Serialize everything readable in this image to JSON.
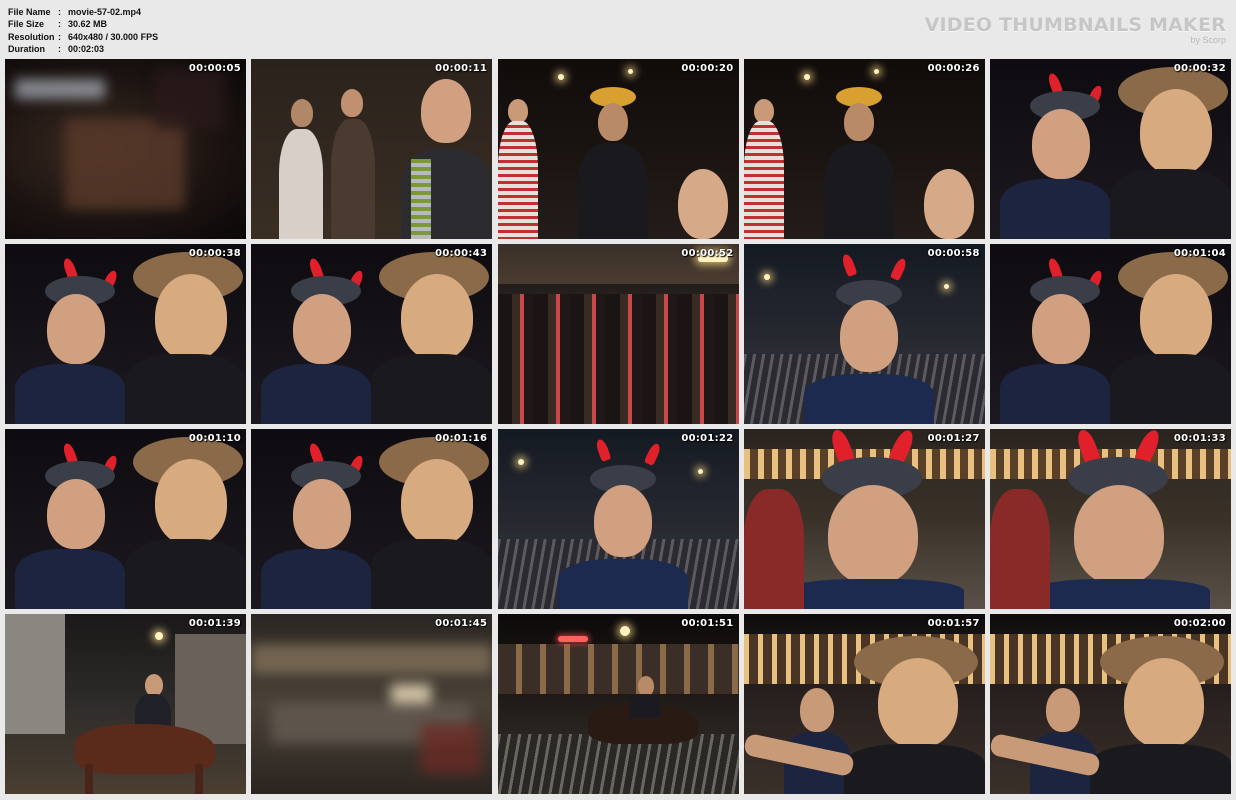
{
  "info": {
    "file_name_label": "File Name",
    "file_name": "movie-57-02.mp4",
    "file_size_label": "File Size",
    "file_size": "30.62 MB",
    "resolution_label": "Resolution",
    "resolution": "640x480 / 30.000 FPS",
    "duration_label": "Duration",
    "duration": "00:02:03",
    "separator": ":"
  },
  "brand": {
    "title": "VIDEO THUMBNAILS MAKER",
    "subtitle": "by Scorp"
  },
  "thumbnails": [
    {
      "timestamp": "00:00:05",
      "scene": "blur-crowd"
    },
    {
      "timestamp": "00:00:11",
      "scene": "crowd-man-closeup"
    },
    {
      "timestamp": "00:00:20",
      "scene": "police-crowd"
    },
    {
      "timestamp": "00:00:26",
      "scene": "police-crowd"
    },
    {
      "timestamp": "00:00:32",
      "scene": "two-men-horns-hat"
    },
    {
      "timestamp": "00:00:38",
      "scene": "two-men-horns-hat"
    },
    {
      "timestamp": "00:00:43",
      "scene": "two-men-horns-hat"
    },
    {
      "timestamp": "00:00:52",
      "scene": "street-crowd"
    },
    {
      "timestamp": "00:00:58",
      "scene": "horned-man-street"
    },
    {
      "timestamp": "00:01:04",
      "scene": "two-men-horns-hat"
    },
    {
      "timestamp": "00:01:10",
      "scene": "two-men-horns-hat"
    },
    {
      "timestamp": "00:01:16",
      "scene": "two-men-horns-hat"
    },
    {
      "timestamp": "00:01:22",
      "scene": "horned-man-street"
    },
    {
      "timestamp": "00:01:27",
      "scene": "horned-man-closeup"
    },
    {
      "timestamp": "00:01:33",
      "scene": "horned-man-closeup"
    },
    {
      "timestamp": "00:01:39",
      "scene": "horse-rider"
    },
    {
      "timestamp": "00:01:45",
      "scene": "blur-street"
    },
    {
      "timestamp": "00:01:51",
      "scene": "horse-street-night"
    },
    {
      "timestamp": "00:01:57",
      "scene": "hat-man-hotel"
    },
    {
      "timestamp": "00:02:00",
      "scene": "hat-man-hotel"
    }
  ],
  "colors": {
    "background": "#e9e9e9",
    "timestamp_text": "#ffffff",
    "brand_text": "#c6c6c6"
  }
}
